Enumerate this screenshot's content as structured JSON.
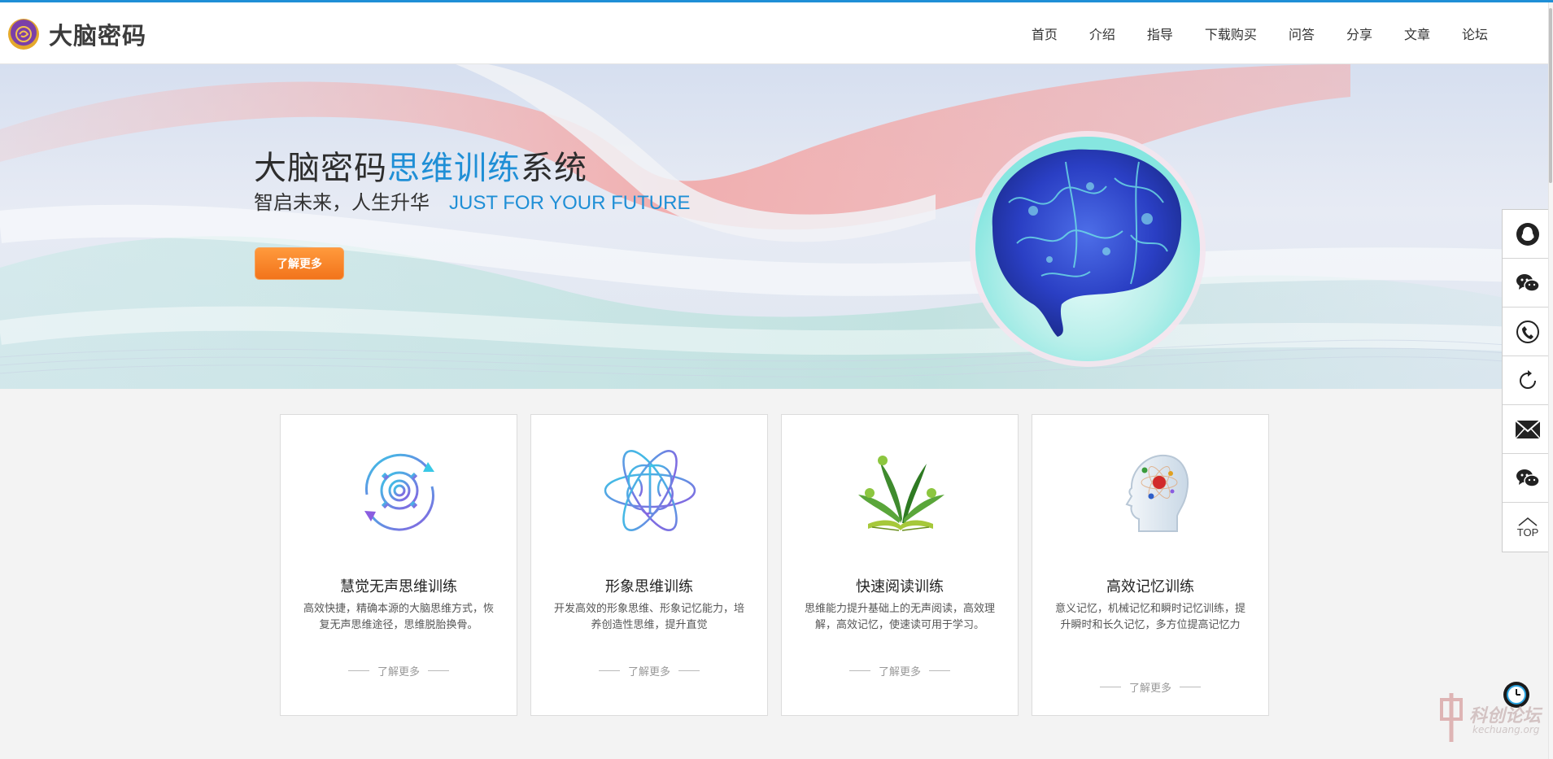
{
  "header": {
    "logo_text": "大脑密码",
    "nav": [
      "首页",
      "介绍",
      "指导",
      "下载购买",
      "问答",
      "分享",
      "文章",
      "论坛"
    ]
  },
  "hero": {
    "title_prefix": "大脑密码",
    "title_highlight": "思维训练",
    "title_suffix": "系统",
    "subtitle_cn": "智启未来，人生升华",
    "subtitle_en": "JUST FOR YOUR FUTURE",
    "button_label": "了解更多"
  },
  "cards": [
    {
      "icon": "gear-cycle-icon",
      "title": "慧觉无声思维训练",
      "desc": "高效快捷，精确本源的大脑思维方式，恢复无声思维途径，思维脱胎换骨。",
      "more": "了解更多"
    },
    {
      "icon": "brain-atom-icon",
      "title": "形象思维训练",
      "desc": "开发高效的形象思维、形象记忆能力，培养创造性思维，提升直觉",
      "more": "了解更多"
    },
    {
      "icon": "growing-book-icon",
      "title": "快速阅读训练",
      "desc": "思维能力提升基础上的无声阅读，高效理解，高效记忆，使速读可用于学习。",
      "more": "了解更多"
    },
    {
      "icon": "head-molecule-icon",
      "title": "高效记忆训练",
      "desc": "意义记忆，机械记忆和瞬时记忆训练，提升瞬时和长久记忆，多方位提高记忆力",
      "more": "了解更多"
    }
  ],
  "sidebar": {
    "items": [
      "qq-icon",
      "wechat-icon",
      "phone-icon",
      "refresh-icon",
      "mail-icon",
      "wechat-icon"
    ],
    "top_label": "TOP"
  },
  "watermark": {
    "text_cn": "科创论坛",
    "text_en": "kechuang.org"
  },
  "colors": {
    "accent": "#1f8fd6",
    "button": "#f2741b"
  }
}
